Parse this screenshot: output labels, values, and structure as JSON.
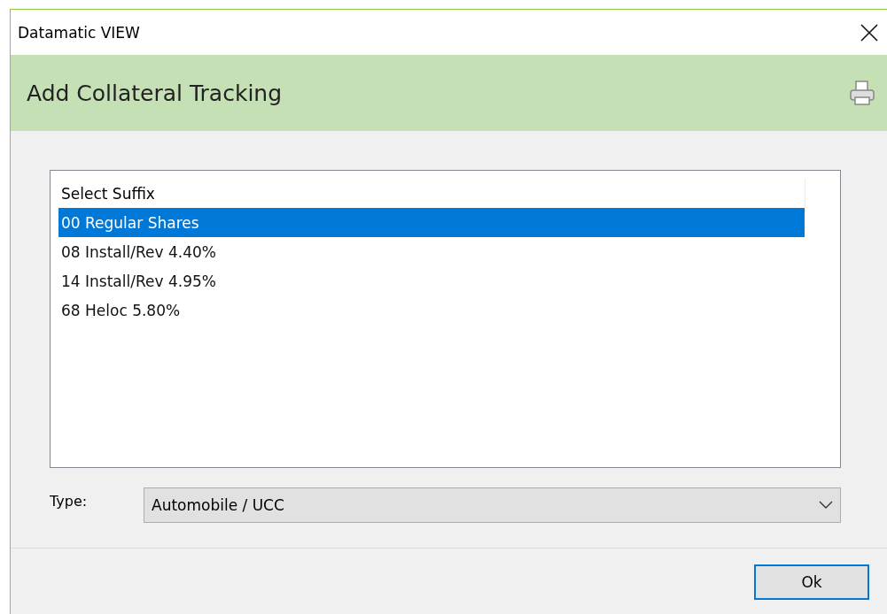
{
  "window": {
    "title": "Datamatic VIEW"
  },
  "header": {
    "title": "Add Collateral Tracking"
  },
  "suffix_list": {
    "heading": "Select Suffix",
    "items": [
      {
        "label": "00 Regular Shares",
        "selected": true
      },
      {
        "label": "08 Install/Rev 4.40%",
        "selected": false
      },
      {
        "label": "14 Install/Rev 4.95%",
        "selected": false
      },
      {
        "label": "68 Heloc 5.80%",
        "selected": false
      }
    ]
  },
  "type_field": {
    "label": "Type:",
    "value": "Automobile / UCC"
  },
  "buttons": [
    {
      "label": "Ok",
      "default": true
    }
  ]
}
